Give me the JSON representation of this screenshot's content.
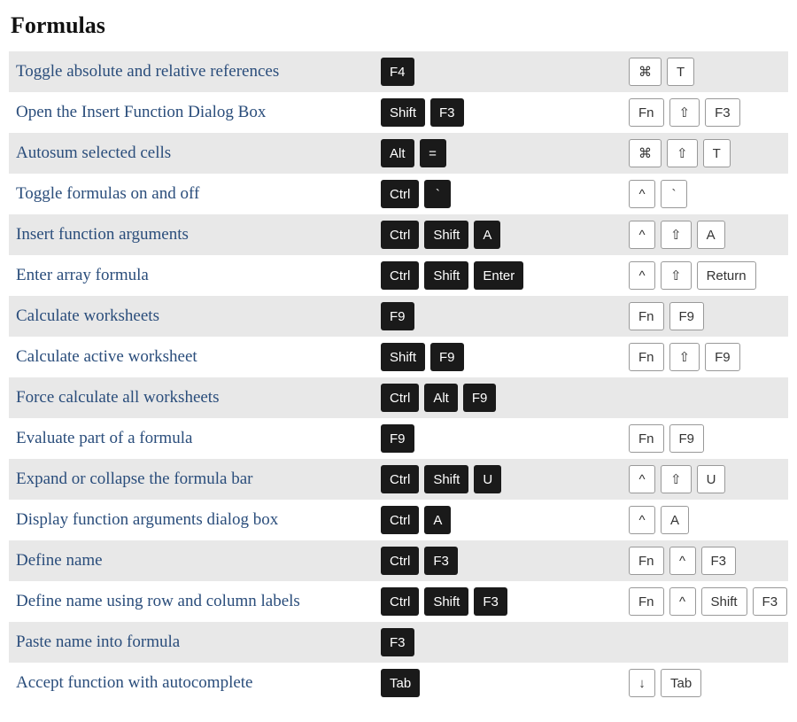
{
  "title": "Formulas",
  "rows": [
    {
      "label": "Toggle absolute and relative references",
      "win": [
        "F4"
      ],
      "mac": [
        "⌘",
        "T"
      ]
    },
    {
      "label": "Open the Insert Function Dialog Box",
      "win": [
        "Shift",
        "F3"
      ],
      "mac": [
        "Fn",
        "⇧",
        "F3"
      ]
    },
    {
      "label": "Autosum selected cells",
      "win": [
        "Alt",
        "="
      ],
      "mac": [
        "⌘",
        "⇧",
        "T"
      ]
    },
    {
      "label": "Toggle formulas on and off",
      "win": [
        "Ctrl",
        "`"
      ],
      "mac": [
        "^",
        "`"
      ]
    },
    {
      "label": "Insert function arguments",
      "win": [
        "Ctrl",
        "Shift",
        "A"
      ],
      "mac": [
        "^",
        "⇧",
        "A"
      ]
    },
    {
      "label": "Enter array formula",
      "win": [
        "Ctrl",
        "Shift",
        "Enter"
      ],
      "mac": [
        "^",
        "⇧",
        "Return"
      ]
    },
    {
      "label": "Calculate worksheets",
      "win": [
        "F9"
      ],
      "mac": [
        "Fn",
        "F9"
      ]
    },
    {
      "label": "Calculate active worksheet",
      "win": [
        "Shift",
        "F9"
      ],
      "mac": [
        "Fn",
        "⇧",
        "F9"
      ]
    },
    {
      "label": "Force calculate all worksheets",
      "win": [
        "Ctrl",
        "Alt",
        "F9"
      ],
      "mac": []
    },
    {
      "label": "Evaluate part of a formula",
      "win": [
        "F9"
      ],
      "mac": [
        "Fn",
        "F9"
      ]
    },
    {
      "label": "Expand or collapse the formula bar",
      "win": [
        "Ctrl",
        "Shift",
        "U"
      ],
      "mac": [
        "^",
        "⇧",
        "U"
      ]
    },
    {
      "label": "Display function arguments dialog box",
      "win": [
        "Ctrl",
        "A"
      ],
      "mac": [
        "^",
        "A"
      ]
    },
    {
      "label": "Define name",
      "win": [
        "Ctrl",
        "F3"
      ],
      "mac": [
        "Fn",
        "^",
        "F3"
      ]
    },
    {
      "label": "Define name using row and column labels",
      "win": [
        "Ctrl",
        "Shift",
        "F3"
      ],
      "mac": [
        "Fn",
        "^",
        "Shift",
        "F3"
      ]
    },
    {
      "label": "Paste name into formula",
      "win": [
        "F3"
      ],
      "mac": []
    },
    {
      "label": "Accept function with autocomplete",
      "win": [
        "Tab"
      ],
      "mac": [
        "↓",
        "Tab"
      ]
    }
  ]
}
